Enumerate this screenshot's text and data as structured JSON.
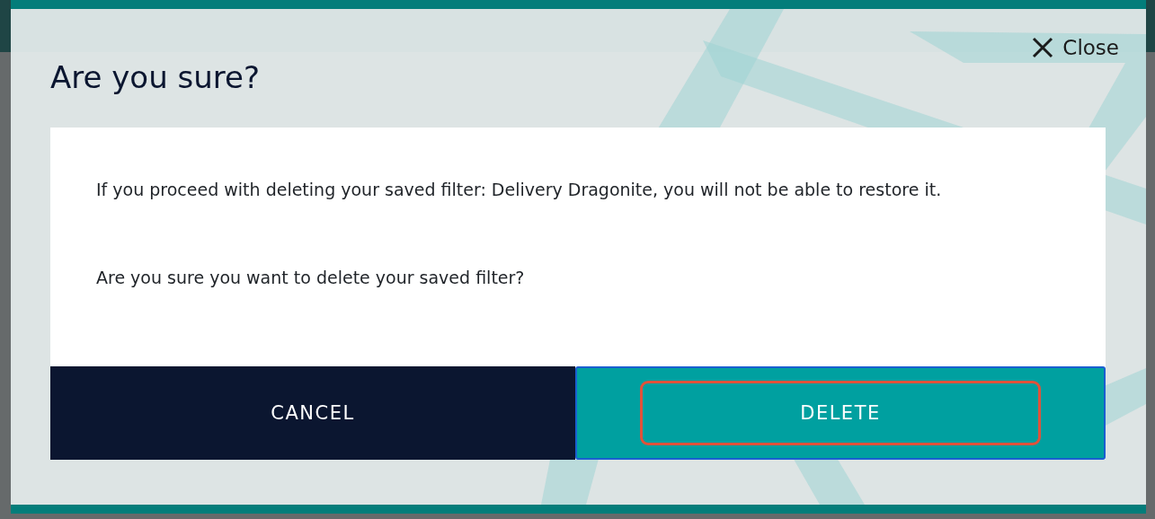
{
  "dialog": {
    "title": "Are you sure?",
    "close_label": "Close",
    "messages": [
      "If you proceed with deleting your saved filter: Delivery Dragonite, you will not be able to restore it.",
      "Are you sure you want to delete your saved filter?"
    ],
    "buttons": [
      {
        "label": "CANCEL",
        "kind": "secondary",
        "focused": false
      },
      {
        "label": "DELETE",
        "kind": "primary",
        "focused": true
      }
    ]
  }
}
